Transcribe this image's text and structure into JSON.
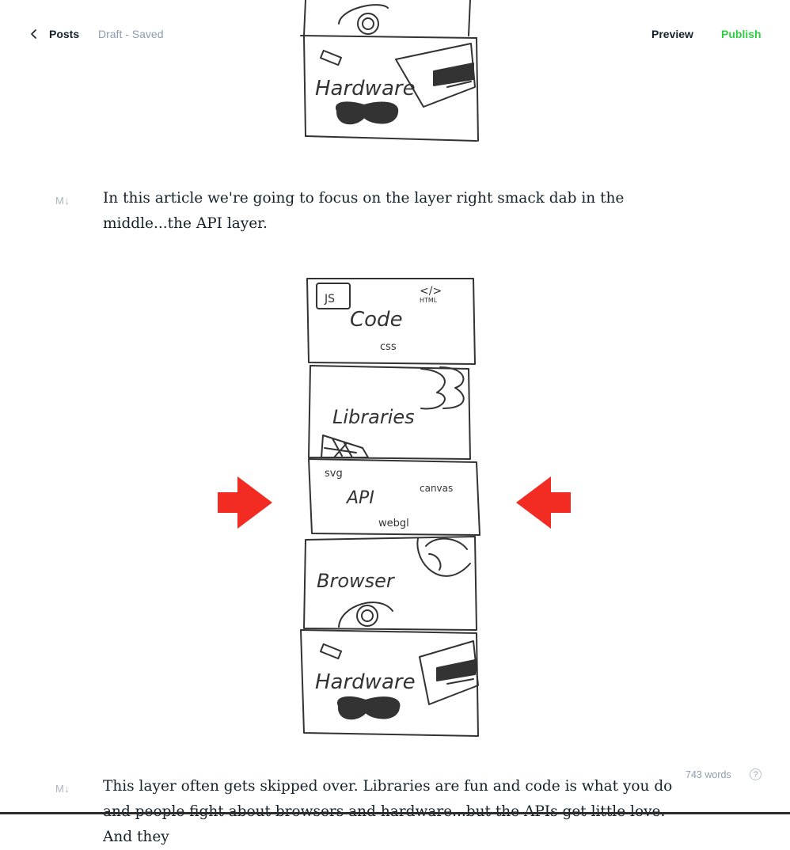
{
  "topbar": {
    "back_label": "Posts",
    "status": "Draft - Saved",
    "preview_label": "Preview",
    "publish_label": "Publish"
  },
  "markdown_badge": "M↓",
  "paragraphs": [
    "In this article we're going to focus on the layer right smack dab in the middle...the API layer.",
    "This layer often gets skipped over. Libraries are fun and code is what you do and people fight about browsers and hardware...but the APIs get little love. And they"
  ],
  "figure_top": {
    "layers": [
      "Hardware"
    ]
  },
  "figure_main": {
    "layers": [
      "Code",
      "Libraries",
      "API",
      "Browser",
      "Hardware"
    ],
    "labels": {
      "js": "JS",
      "html_tag": "</>",
      "html": "HTML",
      "css": "css",
      "svg": "svg",
      "canvas": "canvas",
      "webgl": "webgl"
    }
  },
  "footer": {
    "word_count": "743 words",
    "help": "?"
  },
  "colors": {
    "accent_green": "#30cf43",
    "arrow_red": "#f22c22"
  }
}
